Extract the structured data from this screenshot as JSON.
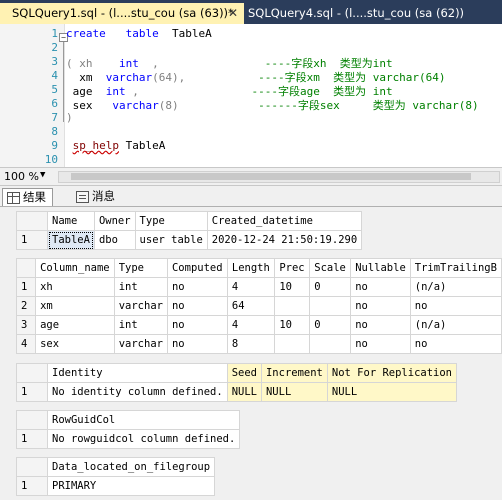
{
  "tabs": {
    "active": "SQLQuery1.sql - (l....stu_cou (sa (63))*",
    "close": "✕",
    "inactive": "SQLQuery4.sql - (l....stu_cou (sa (62))"
  },
  "editor": {
    "line_numbers": [
      "1",
      "2",
      "3",
      "4",
      "5",
      "6",
      "7",
      "8",
      "9",
      "10"
    ],
    "line1_kw1": "create",
    "line1_kw2": "table",
    "line1_name": "TableA",
    "line3_open": "( xh",
    "line3_type": "int",
    "line3_comma": ",",
    "line3_comment": "----字段xh  类型为int",
    "line4_col": "xm",
    "line4_type": "varchar",
    "line4_rest": "(64),",
    "line4_comment": "----字段xm  类型为 varchar(64)",
    "line5_col": "age",
    "line5_type": "int",
    "line5_rest": ",",
    "line5_comment": "----字段age  类型为 int",
    "line6_col": "sex",
    "line6_type": "varchar",
    "line6_rest": "(8)",
    "line6_comment": "------字段sex     类型为 varchar(8)",
    "line7": ")",
    "line9_fn": "sp_help",
    "line9_arg": "TableA"
  },
  "status": {
    "zoom": "100 %"
  },
  "result_tabs": {
    "results": "结果",
    "messages": "消息"
  },
  "table1": {
    "headers": [
      "Name",
      "Owner",
      "Type",
      "Created_datetime"
    ],
    "rows": [
      [
        "1",
        "TableA",
        "dbo",
        "user table",
        "2020-12-24 21:50:19.290"
      ]
    ]
  },
  "table2": {
    "headers": [
      "Column_name",
      "Type",
      "Computed",
      "Length",
      "Prec",
      "Scale",
      "Nullable",
      "TrimTrailingB"
    ],
    "rows": [
      [
        "1",
        "xh",
        "int",
        "no",
        "4",
        "10",
        "0",
        "no",
        "(n/a)"
      ],
      [
        "2",
        "xm",
        "varchar",
        "no",
        "64",
        "",
        "",
        "no",
        "no"
      ],
      [
        "3",
        "age",
        "int",
        "no",
        "4",
        "10",
        "0",
        "no",
        "(n/a)"
      ],
      [
        "4",
        "sex",
        "varchar",
        "no",
        "8",
        "",
        "",
        "no",
        "no"
      ]
    ]
  },
  "table3": {
    "headers": [
      "Identity",
      "Seed",
      "Increment",
      "Not For Replication"
    ],
    "rows": [
      [
        "1",
        "No identity column defined.",
        "NULL",
        "NULL",
        "NULL"
      ]
    ]
  },
  "table4": {
    "headers": [
      "RowGuidCol"
    ],
    "rows": [
      [
        "1",
        "No rowguidcol column defined."
      ]
    ]
  },
  "table5": {
    "headers": [
      "Data_located_on_filegroup"
    ],
    "rows": [
      [
        "1",
        "PRIMARY"
      ]
    ]
  }
}
